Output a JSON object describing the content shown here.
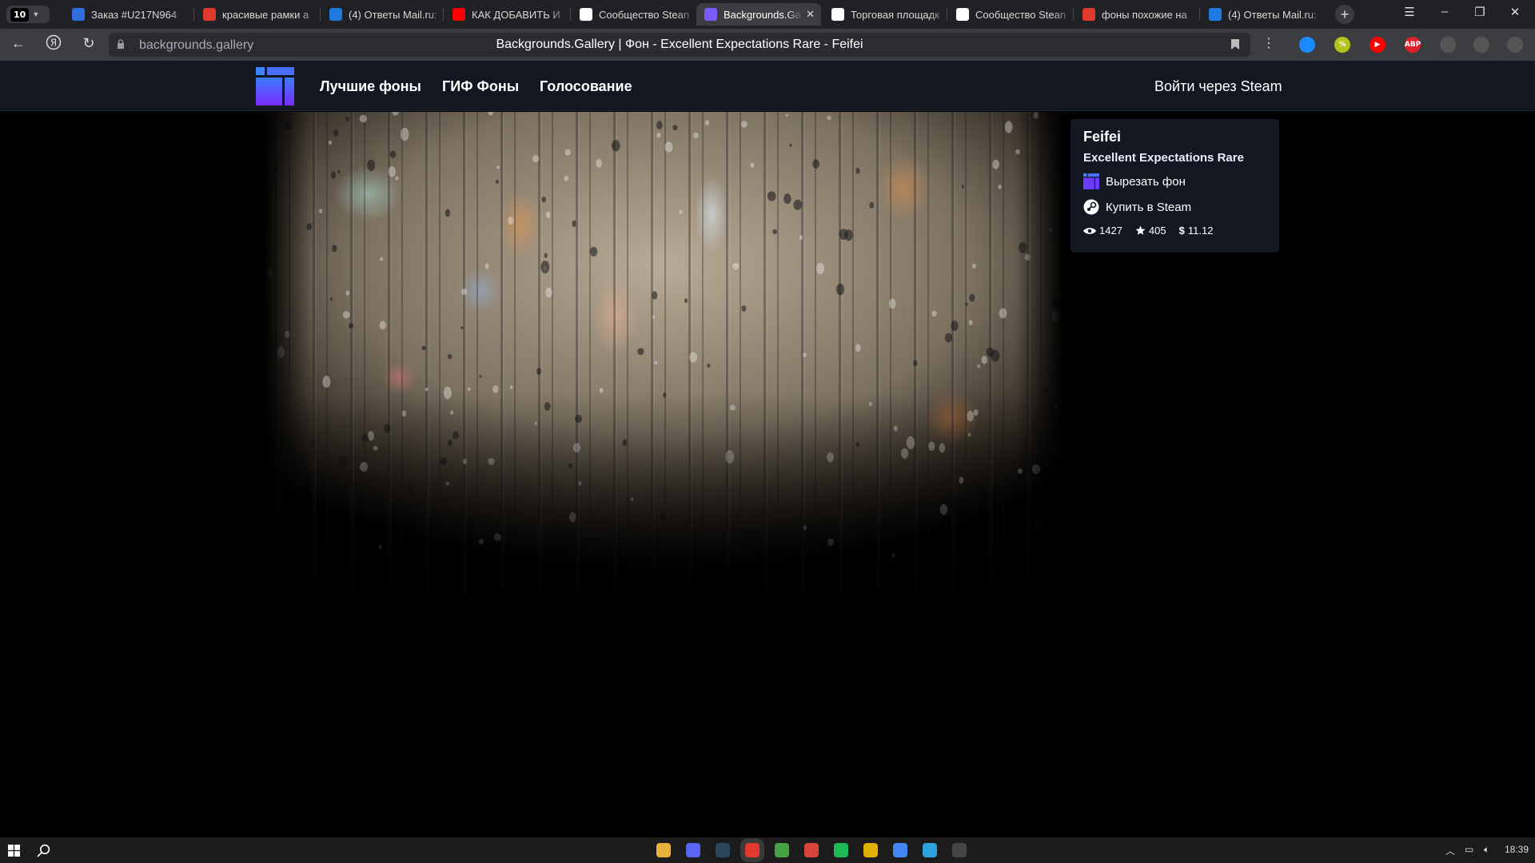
{
  "browser": {
    "tab_count": "10",
    "tabs": [
      {
        "title": "Заказ #U217N964",
        "icon": "freelance-f-icon",
        "color": "#2f6fdf"
      },
      {
        "title": "красивые рамки а",
        "icon": "yandex-icon",
        "color": "#e03a2f"
      },
      {
        "title": "(4) Ответы Mail.ru:",
        "icon": "mail-answers-icon",
        "color": "#1f7ae0"
      },
      {
        "title": "КАК ДОБАВИТЬ И",
        "icon": "youtube-icon",
        "color": "#ff0000"
      },
      {
        "title": "Сообщество Stean",
        "icon": "steam-icon",
        "color": "#ffffff"
      },
      {
        "title": "Backgrounds.Ga",
        "icon": "backgrounds-gallery-icon",
        "color": "#7b5cff"
      },
      {
        "title": "Торговая площадк",
        "icon": "steam-icon",
        "color": "#ffffff"
      },
      {
        "title": "Сообщество Stean",
        "icon": "steam-icon",
        "color": "#ffffff"
      },
      {
        "title": "фоны похожие на",
        "icon": "yandex-icon",
        "color": "#e03a2f"
      },
      {
        "title": "(4) Ответы Mail.ru:",
        "icon": "mail-answers-icon",
        "color": "#1f7ae0"
      }
    ],
    "active_tab_index": 5,
    "url": "backgrounds.gallery",
    "page_title": "Backgrounds.Gallery | Фон - Excellent Expectations Rare - Feifei",
    "extensions": [
      {
        "name": "shazam-icon",
        "label": "",
        "color": "#1a8cff"
      },
      {
        "name": "coupon-icon",
        "label": "%",
        "color": "#b5c21c"
      },
      {
        "name": "youtube-icon",
        "label": "▶",
        "color": "#ff0000"
      },
      {
        "name": "adblock-plus-icon",
        "label": "ABP",
        "color": "#e0202a"
      },
      {
        "name": "media-play-icon",
        "label": "",
        "color": "#555"
      },
      {
        "name": "extensions-icon",
        "label": "",
        "color": "#555"
      },
      {
        "name": "download-icon",
        "label": "",
        "color": "#555"
      }
    ]
  },
  "site": {
    "nav": [
      "Лучшие фоны",
      "ГИФ Фоны",
      "Голосование"
    ],
    "login": "Войти через Steam",
    "accent": "#6c4cff"
  },
  "card": {
    "name": "Feifei",
    "item": "Excellent Expectations Rare",
    "cut_label": "Вырезать фон",
    "buy_label": "Купить в Steam",
    "views": "1427",
    "stars": "405",
    "price": "11.12",
    "currency": "$"
  },
  "taskbar": {
    "apps": [
      "file-explorer-icon",
      "discord-icon",
      "steam-icon",
      "yandex-browser-icon",
      "utorrent-icon",
      "app-red-icon",
      "spotify-icon",
      "app-yellow-icon",
      "chrome-icon",
      "telegram-icon",
      "app-dark-icon"
    ],
    "time": "18:39"
  }
}
